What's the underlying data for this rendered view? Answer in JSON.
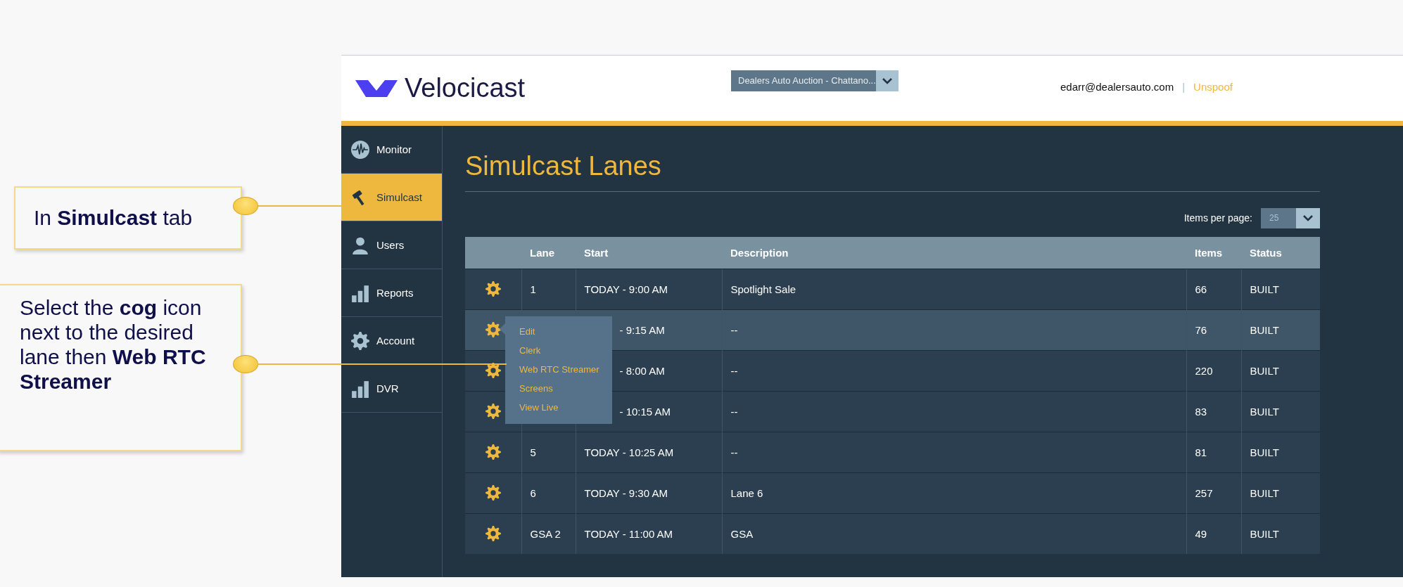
{
  "callouts": [
    {
      "text": "In **Simulcast** tab"
    },
    {
      "text": "Select the **cog** icon next to the desired lane then **Web RTC Streamer**"
    }
  ],
  "header": {
    "logo": "Velocicast",
    "auction_select": "Dealers Auto Auction - Chattano...",
    "email": "edarr@dealersauto.com",
    "separator": "|",
    "link": "Unspoof"
  },
  "sidebar": {
    "items": [
      {
        "label": "Monitor",
        "selected": false
      },
      {
        "label": "Simulcast",
        "selected": true
      },
      {
        "label": "Users",
        "selected": false
      },
      {
        "label": "Reports",
        "selected": false
      },
      {
        "label": "Account",
        "selected": false
      },
      {
        "label": "DVR",
        "selected": false
      }
    ]
  },
  "page": {
    "title": "Simulcast Lanes",
    "items_per_page_label": "Items per page:",
    "items_per_page": "25"
  },
  "table": {
    "columns": [
      "Lane",
      "Start",
      "Description",
      "Items",
      "Status"
    ],
    "rows": [
      {
        "lane": "1",
        "start": "TODAY - 9:00 AM",
        "description": "Spotlight Sale",
        "items": "66",
        "status": "BUILT",
        "hovered": false
      },
      {
        "start": "- 9:15 AM",
        "description": "--",
        "items": "76",
        "status": "BUILT",
        "hovered": true
      },
      {
        "start": "- 8:00 AM",
        "description": "--",
        "items": "220",
        "status": "BUILT",
        "hovered": false
      },
      {
        "start": "- 10:15 AM",
        "description": "--",
        "items": "83",
        "status": "BUILT",
        "hovered": false
      },
      {
        "lane": "5",
        "start": "TODAY - 10:25 AM",
        "description": "--",
        "items": "81",
        "status": "BUILT",
        "hovered": false
      },
      {
        "lane": "6",
        "start": "TODAY - 9:30 AM",
        "description": "Lane 6",
        "items": "257",
        "status": "BUILT",
        "hovered": false
      },
      {
        "lane": "GSA 2",
        "start": "TODAY - 11:00 AM",
        "description": "GSA",
        "items": "49",
        "status": "BUILT",
        "hovered": false
      }
    ]
  },
  "row_menu": {
    "items": [
      "Edit",
      "Clerk",
      "Web RTC Streamer",
      "Screens",
      "View Live"
    ]
  }
}
